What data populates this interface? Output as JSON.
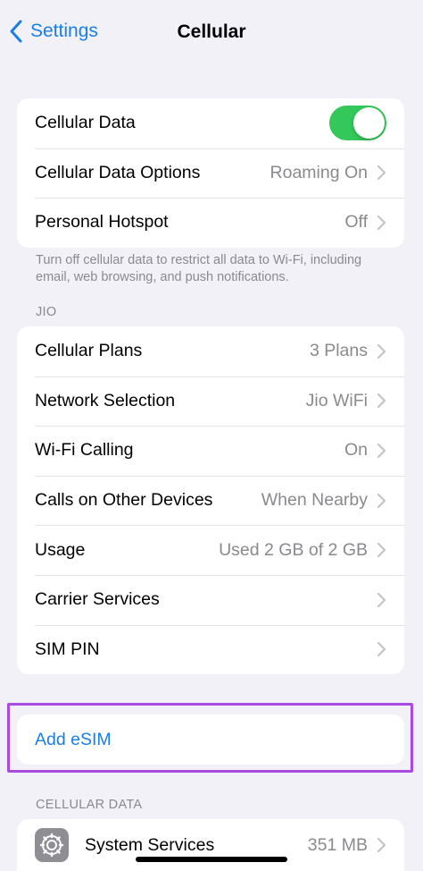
{
  "nav": {
    "back_label": "Settings",
    "title": "Cellular"
  },
  "colors": {
    "accent": "#1a7ee8",
    "toggle_on": "#34c759",
    "highlight_border": "#a84be0",
    "background": "#f2f1f7"
  },
  "group1": {
    "rows": [
      {
        "label": "Cellular Data",
        "toggle": true
      },
      {
        "label": "Cellular Data Options",
        "value": "Roaming On"
      },
      {
        "label": "Personal Hotspot",
        "value": "Off"
      }
    ],
    "footnote": "Turn off cellular data to restrict all data to Wi-Fi, including email, web browsing, and push notifications."
  },
  "jio": {
    "header": "JIO",
    "rows": [
      {
        "label": "Cellular Plans",
        "value": "3 Plans"
      },
      {
        "label": "Network Selection",
        "value": "Jio WiFi"
      },
      {
        "label": "Wi-Fi Calling",
        "value": "On"
      },
      {
        "label": "Calls on Other Devices",
        "value": "When Nearby"
      },
      {
        "label": "Usage",
        "value": "Used 2 GB of 2 GB"
      },
      {
        "label": "Carrier Services",
        "value": ""
      },
      {
        "label": "SIM PIN",
        "value": ""
      }
    ]
  },
  "esim": {
    "label": "Add eSIM"
  },
  "cellular_data": {
    "header": "CELLULAR DATA",
    "rows": [
      {
        "label": "System Services",
        "value": "351 MB",
        "icon": "gear-icon"
      }
    ]
  }
}
